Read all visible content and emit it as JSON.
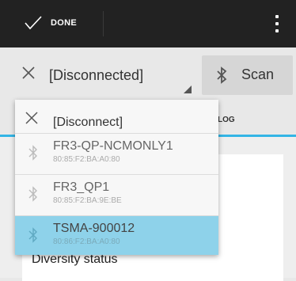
{
  "actionbar": {
    "done_label": "DONE"
  },
  "toolbar": {
    "device_spinner": "[Disconnected]",
    "scan_label": "Scan"
  },
  "tabs": {
    "log_label": "LOG"
  },
  "content": {
    "diversity_label": "Diversity status"
  },
  "dropdown": {
    "disconnect_label": "[Disconnect]",
    "devices": [
      {
        "name": "FR3-QP-NCMONLY1",
        "mac": "80:85:F2:BA:A0:80"
      },
      {
        "name": "FR3_QP1",
        "mac": "80:85:F2:BA:9E:BE"
      },
      {
        "name": "TSMA-900012",
        "mac": "80:86:F2:BA:A0:80"
      }
    ]
  },
  "colors": {
    "actionbar_bg": "#222222",
    "accent": "#33b5e5",
    "selected_item": "#8ed2ea"
  }
}
